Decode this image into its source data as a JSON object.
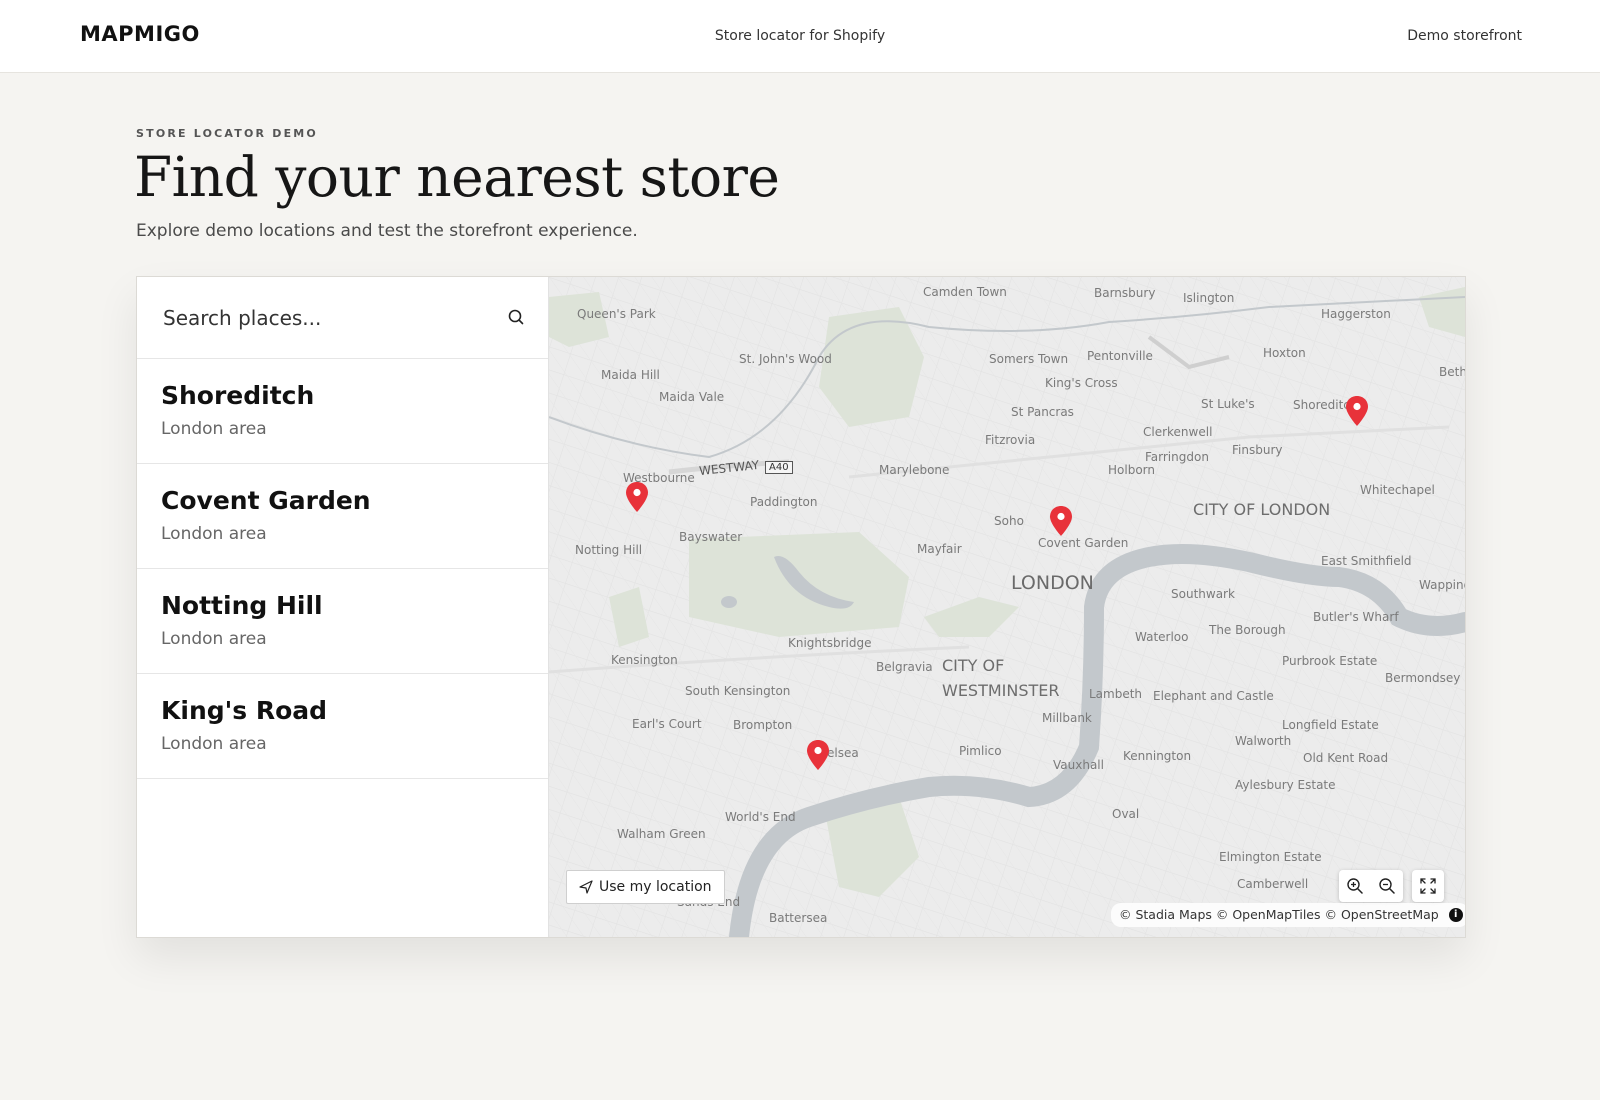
{
  "header": {
    "brand": "MAPMIGO",
    "tagline": "Store locator for Shopify",
    "demo_link": "Demo storefront"
  },
  "hero": {
    "eyebrow": "STORE LOCATOR DEMO",
    "title": "Find your nearest store",
    "subtitle": "Explore demo locations and test the storefront experience."
  },
  "search": {
    "placeholder": "Search places..."
  },
  "stores": [
    {
      "name": "Shoreditch",
      "area": "London area"
    },
    {
      "name": "Covent Garden",
      "area": "London area"
    },
    {
      "name": "Notting Hill",
      "area": "London area"
    },
    {
      "name": "King's Road",
      "area": "London area"
    }
  ],
  "map": {
    "labels": {
      "camden": "Camden Town",
      "barnsbury": "Barnsbury",
      "islington": "Islington",
      "haggerston": "Haggerston",
      "queens_park": "Queen's Park",
      "st_johns_wood": "St. John's Wood",
      "somers_town": "Somers Town",
      "pentonville": "Pentonville",
      "hoxton": "Hoxton",
      "bethnal": "Bethn",
      "maida_hill": "Maida Hill",
      "kings_cross": "King's Cross",
      "maida_vale": "Maida Vale",
      "st_pancras": "St Pancras",
      "st_lukes": "St Luke's",
      "shoreditch": "Shoreditch",
      "clerkenwell": "Clerkenwell",
      "fitzrovia": "Fitzrovia",
      "finsbury": "Finsbury",
      "farringdon": "Farringdon",
      "westway": "WESTWAY",
      "a40": "A40",
      "westbourne": "Westbourne",
      "marylebone": "Marylebone",
      "holborn": "Holborn",
      "whitechapel": "Whitechapel",
      "paddington": "Paddington",
      "city_of_london": "CITY OF LONDON",
      "soho": "Soho",
      "covent_garden": "Covent Garden",
      "bayswater": "Bayswater",
      "notting_hill": "Notting Hill",
      "mayfair": "Mayfair",
      "east_smithfield": "East Smithfield",
      "london": "LONDON",
      "wapping": "Wapping",
      "southwark": "Southwark",
      "butlers_wharf": "Butler's Wharf",
      "the_borough": "The Borough",
      "knightsbridge": "Knightsbridge",
      "waterloo": "Waterloo",
      "kensington": "Kensington",
      "belgravia": "Belgravia",
      "city_of": "CITY OF",
      "westminster": "WESTMINSTER",
      "purbrook": "Purbrook Estate",
      "bermondsey": "Bermondsey",
      "south_kensington": "South Kensington",
      "lambeth": "Lambeth",
      "elephant": "Elephant and Castle",
      "earls_court": "Earl's Court",
      "brompton": "Brompton",
      "millbank": "Millbank",
      "longfield": "Longfield Estate",
      "walworth": "Walworth",
      "chelsea": "Chelsea",
      "pimlico": "Pimlico",
      "kennington": "Kennington",
      "old_kent": "Old Kent Road",
      "vauxhall": "Vauxhall",
      "aylesbury": "Aylesbury Estate",
      "worlds_end": "World's End",
      "oval": "Oval",
      "walham_green": "Walham Green",
      "elmington": "Elmington Estate",
      "camberwell": "Camberwell",
      "sands_end": "Sands End",
      "battersea": "Battersea"
    },
    "use_location_label": "Use my location",
    "attribution": "© Stadia Maps © OpenMapTiles © OpenStreetMap",
    "info_glyph": "i",
    "pin_color": "#e8323a",
    "river_color": "#c3c8cc",
    "park_color": "#dde3d8"
  }
}
